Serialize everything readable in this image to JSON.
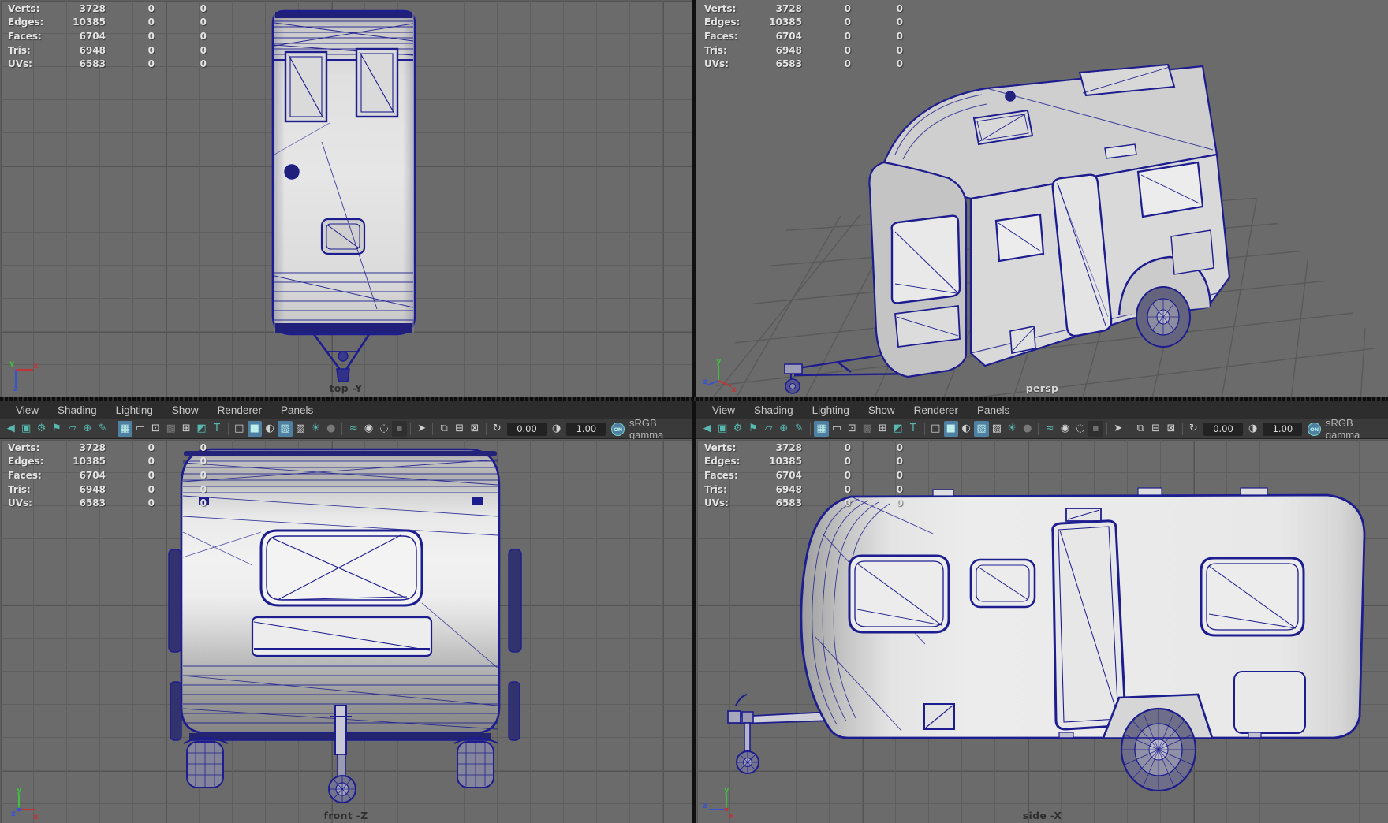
{
  "viewports": {
    "top": {
      "label": "top -Y"
    },
    "persp": {
      "label": "persp"
    },
    "front": {
      "label": "front -Z"
    },
    "side": {
      "label": "side -X"
    }
  },
  "hud": {
    "rows": [
      {
        "label": "Verts:",
        "total": "3728",
        "c2": "0",
        "c3": "0"
      },
      {
        "label": "Edges:",
        "total": "10385",
        "c2": "0",
        "c3": "0"
      },
      {
        "label": "Faces:",
        "total": "6704",
        "c2": "0",
        "c3": "0"
      },
      {
        "label": "Tris:",
        "total": "6948",
        "c2": "0",
        "c3": "0"
      },
      {
        "label": "UVs:",
        "total": "6583",
        "c2": "0",
        "c3": "0"
      }
    ]
  },
  "menu": {
    "items": [
      "View",
      "Shading",
      "Lighting",
      "Show",
      "Renderer",
      "Panels"
    ]
  },
  "toolbar": {
    "icons": [
      {
        "name": "camera-icon",
        "glyph": "◀"
      },
      {
        "name": "lock-icon",
        "glyph": "▣"
      },
      {
        "name": "gear-icon",
        "glyph": "⚙"
      },
      {
        "name": "bookmark-icon",
        "glyph": "⚑"
      },
      {
        "name": "image-plane-icon",
        "glyph": "▱"
      },
      {
        "name": "pan-zoom-icon",
        "glyph": "⊕"
      },
      {
        "name": "pencil-icon",
        "glyph": "✎"
      },
      {
        "name": "grid-icon",
        "glyph": "▦"
      },
      {
        "name": "film-gate-icon",
        "glyph": "▭"
      },
      {
        "name": "resolution-gate-icon",
        "glyph": "⊡"
      },
      {
        "name": "gate-mask-icon",
        "glyph": "▩"
      },
      {
        "name": "field-chart-icon",
        "glyph": "⊞"
      },
      {
        "name": "safe-action-icon",
        "glyph": "◩"
      },
      {
        "name": "safe-title-icon",
        "glyph": "T"
      },
      {
        "name": "wireframe-cube-icon",
        "glyph": "□"
      },
      {
        "name": "shaded-cube-icon",
        "glyph": "■"
      },
      {
        "name": "textured-sphere-icon",
        "glyph": "◐"
      },
      {
        "name": "wireframe-on-shaded-icon",
        "glyph": "▧"
      },
      {
        "name": "checker-sphere-icon",
        "glyph": "▨"
      },
      {
        "name": "light-icon",
        "glyph": "☀"
      },
      {
        "name": "shadow-sphere-icon",
        "glyph": "●"
      },
      {
        "name": "texture-view-icon",
        "glyph": "≈"
      },
      {
        "name": "xray-spheres-icon",
        "glyph": "◉"
      },
      {
        "name": "occlusion-ring-icon",
        "glyph": "◌"
      },
      {
        "name": "motion-blur-icon",
        "glyph": "▪"
      },
      {
        "name": "isolate-select-cursor-icon",
        "glyph": "➤"
      },
      {
        "name": "copy-layer-icon",
        "glyph": "⧉"
      },
      {
        "name": "paste-layer-icon",
        "glyph": "⊟"
      },
      {
        "name": "snapshot-icon",
        "glyph": "⊠"
      },
      {
        "name": "exposure-cycle-icon",
        "glyph": "↻"
      },
      {
        "name": "contrast-icon",
        "glyph": "◑"
      }
    ],
    "exposure_value": "0.00",
    "gamma_value": "1.00",
    "on_badge": "ON",
    "colorspace": "sRGB gamma"
  },
  "axis_labels": {
    "x": "x",
    "y": "y",
    "z": "z"
  },
  "colors": {
    "viewport_bg": "#6b6b6b",
    "grid_line": "#5e5e5e",
    "wireframe": "#1d1d8f",
    "icon_teal": "#57b8b0",
    "active_button": "#4f80a2",
    "axis_x": "#d03a3a",
    "axis_y": "#3fc03f",
    "axis_z": "#3a52d0"
  }
}
